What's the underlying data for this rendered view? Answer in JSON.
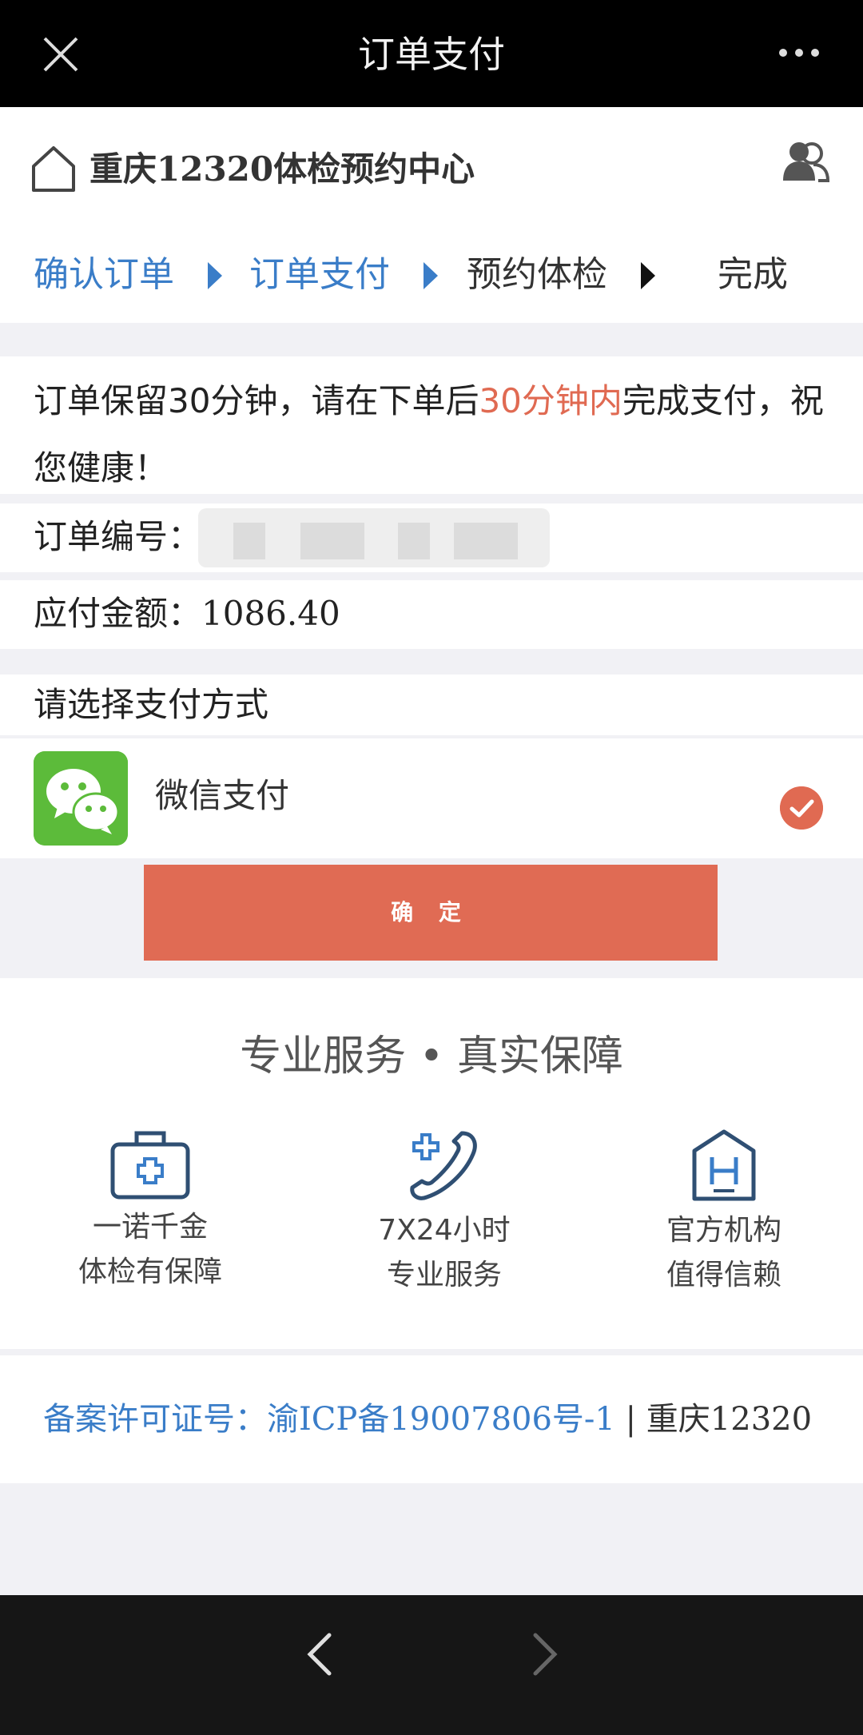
{
  "topbar": {
    "title": "订单支付"
  },
  "header": {
    "site_name": "重庆12320体检预约中心",
    "steps": [
      "确认订单",
      "订单支付",
      "预约体检",
      "完成"
    ]
  },
  "notice": {
    "part1": "订单保留30分钟，请在下单后",
    "highlight": "30分钟内",
    "part2": "完成支付，祝您健康！"
  },
  "order": {
    "order_no_label": "订单编号：",
    "amount_label": "应付金额：",
    "amount_value": "1086.40"
  },
  "payment": {
    "choose_label": "请选择支付方式",
    "method": "微信支付",
    "confirm_label": "确 定"
  },
  "guarantee": {
    "title": "专业服务 • 真实保障",
    "features": [
      {
        "line1": "一诺千金",
        "line2": "体检有保障",
        "icon": "medical-kit-icon"
      },
      {
        "line1": "7X24小时",
        "line2": "专业服务",
        "icon": "phone-medical-icon"
      },
      {
        "line1": "官方机构",
        "line2": "值得信赖",
        "icon": "hospital-building-icon"
      }
    ]
  },
  "footer": {
    "icp": "备案许可证号：渝ICP备19007806号-1",
    "separator": " | ",
    "org": "重庆12320"
  },
  "colors": {
    "accent": "#e06b54",
    "link": "#3a7dc8",
    "wechat": "#5cbb3a"
  }
}
